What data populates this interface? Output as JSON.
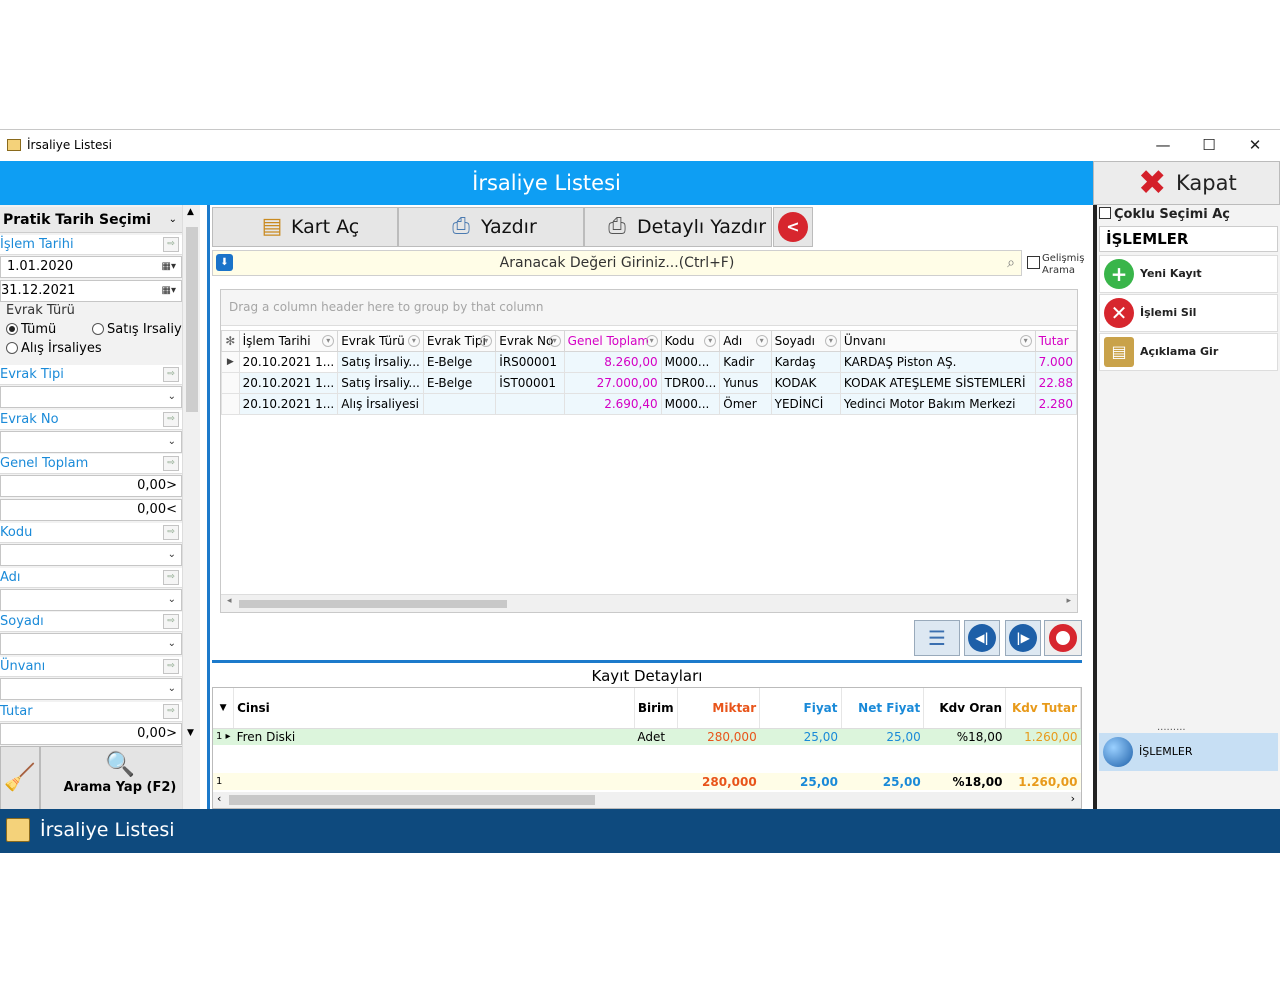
{
  "window": {
    "title": "İrsaliye Listesi",
    "minimize": "—",
    "maximize": "☐",
    "close": "✕"
  },
  "header": {
    "title": "İrsaliye Listesi",
    "close_label": "Kapat"
  },
  "left": {
    "date_header": "Pratik Tarih Seçimi",
    "islem_tarihi": "İşlem Tarihi",
    "date_from": "1.01.2020",
    "date_to": "31.12.2021",
    "evrak_turu": "Evrak Türü",
    "radio_tumu": "Tümü",
    "radio_satis": "Satış İrsaliye",
    "radio_alis": "Alış İrsaliyes",
    "evrak_tipi": "Evrak Tipi",
    "evrak_no": "Evrak No",
    "genel_toplam": "Genel Toplam",
    "gt_min": "0,00>",
    "gt_max": "0,00<",
    "kodu": "Kodu",
    "adi": "Adı",
    "soyadi": "Soyadı",
    "unvani": "Ünvanı",
    "tutar": "Tutar",
    "tutar_min": "0,00>",
    "search_btn": "Arama Yap (F2)"
  },
  "toolbar": {
    "kart_ac": "Kart Aç",
    "yazdir": "Yazdır",
    "detayli_yazdir": "Detaylı Yazdır"
  },
  "search": {
    "placeholder": "Aranacak Değeri Giriniz...(Ctrl+F)",
    "advanced_line1": "Gelişmiş",
    "advanced_line2": "Arama"
  },
  "grid": {
    "group_hint": "Drag a column header here to group by that column",
    "columns": [
      "İşlem Tarihi",
      "Evrak Türü",
      "Evrak Tipi",
      "Evrak No",
      "Genel Toplam",
      "Kodu",
      "Adı",
      "Soyadı",
      "Ünvanı",
      "Tutar"
    ],
    "rows": [
      {
        "tarih": "20.10.2021 1...",
        "tur": "Satış İrsaliy...",
        "tip": "E-Belge",
        "no": "İRS00001",
        "toplam": "8.260,00",
        "kodu": "M000...",
        "adi": "Kadir",
        "soyadi": "Kardaş",
        "unvan": "KARDAŞ Piston AŞ.",
        "tutar": "7.000"
      },
      {
        "tarih": "20.10.2021 1...",
        "tur": "Satış İrsaliy...",
        "tip": "E-Belge",
        "no": "İST00001",
        "toplam": "27.000,00",
        "kodu": "TDR00...",
        "adi": "Yunus",
        "soyadi": "KODAK",
        "unvan": "KODAK ATEŞLEME SİSTEMLERİ",
        "tutar": "22.88"
      },
      {
        "tarih": "20.10.2021 1...",
        "tur": "Alış İrsaliyesi",
        "tip": "",
        "no": "",
        "toplam": "2.690,40",
        "kodu": "M000...",
        "adi": "Ömer",
        "soyadi": "YEDİNCİ",
        "unvan": "Yedinci Motor Bakım Merkezi",
        "tutar": "2.280"
      }
    ]
  },
  "detail": {
    "title": "Kayıt Detayları",
    "columns": {
      "cinsi": "Cinsi",
      "birim": "Birim",
      "miktar": "Miktar",
      "fiyat": "Fiyat",
      "net_fiyat": "Net Fiyat",
      "kdv_oran": "Kdv Oran",
      "kdv_tutar": "Kdv Tutar"
    },
    "row": {
      "idx": "1",
      "cinsi": "Fren Diski",
      "birim": "Adet",
      "miktar": "280,000",
      "fiyat": "25,00",
      "net_fiyat": "25,00",
      "kdv_oran": "%18,00",
      "kdv_tutar": "1.260,00"
    },
    "total": {
      "idx": "1",
      "miktar": "280,000",
      "fiyat": "25,00",
      "net_fiyat": "25,00",
      "kdv_oran": "%18,00",
      "kdv_tutar": "1.260,00"
    }
  },
  "right": {
    "multi_select": "Çoklu Seçimi Aç",
    "islemler": "İŞLEMLER",
    "yeni_kayit": "Yeni Kayıt",
    "islemi_sil": "İşlemi Sil",
    "aciklama": "Açıklama Gir",
    "grip": "·········",
    "islemler2": "İŞLEMLER"
  },
  "status": {
    "text": "İrsaliye Listesi"
  },
  "colors": {
    "accent_blue": "#0e9ef3",
    "status_bar": "#0e4a7e",
    "magenta": "#d400c4",
    "orange": "#e8541a"
  }
}
